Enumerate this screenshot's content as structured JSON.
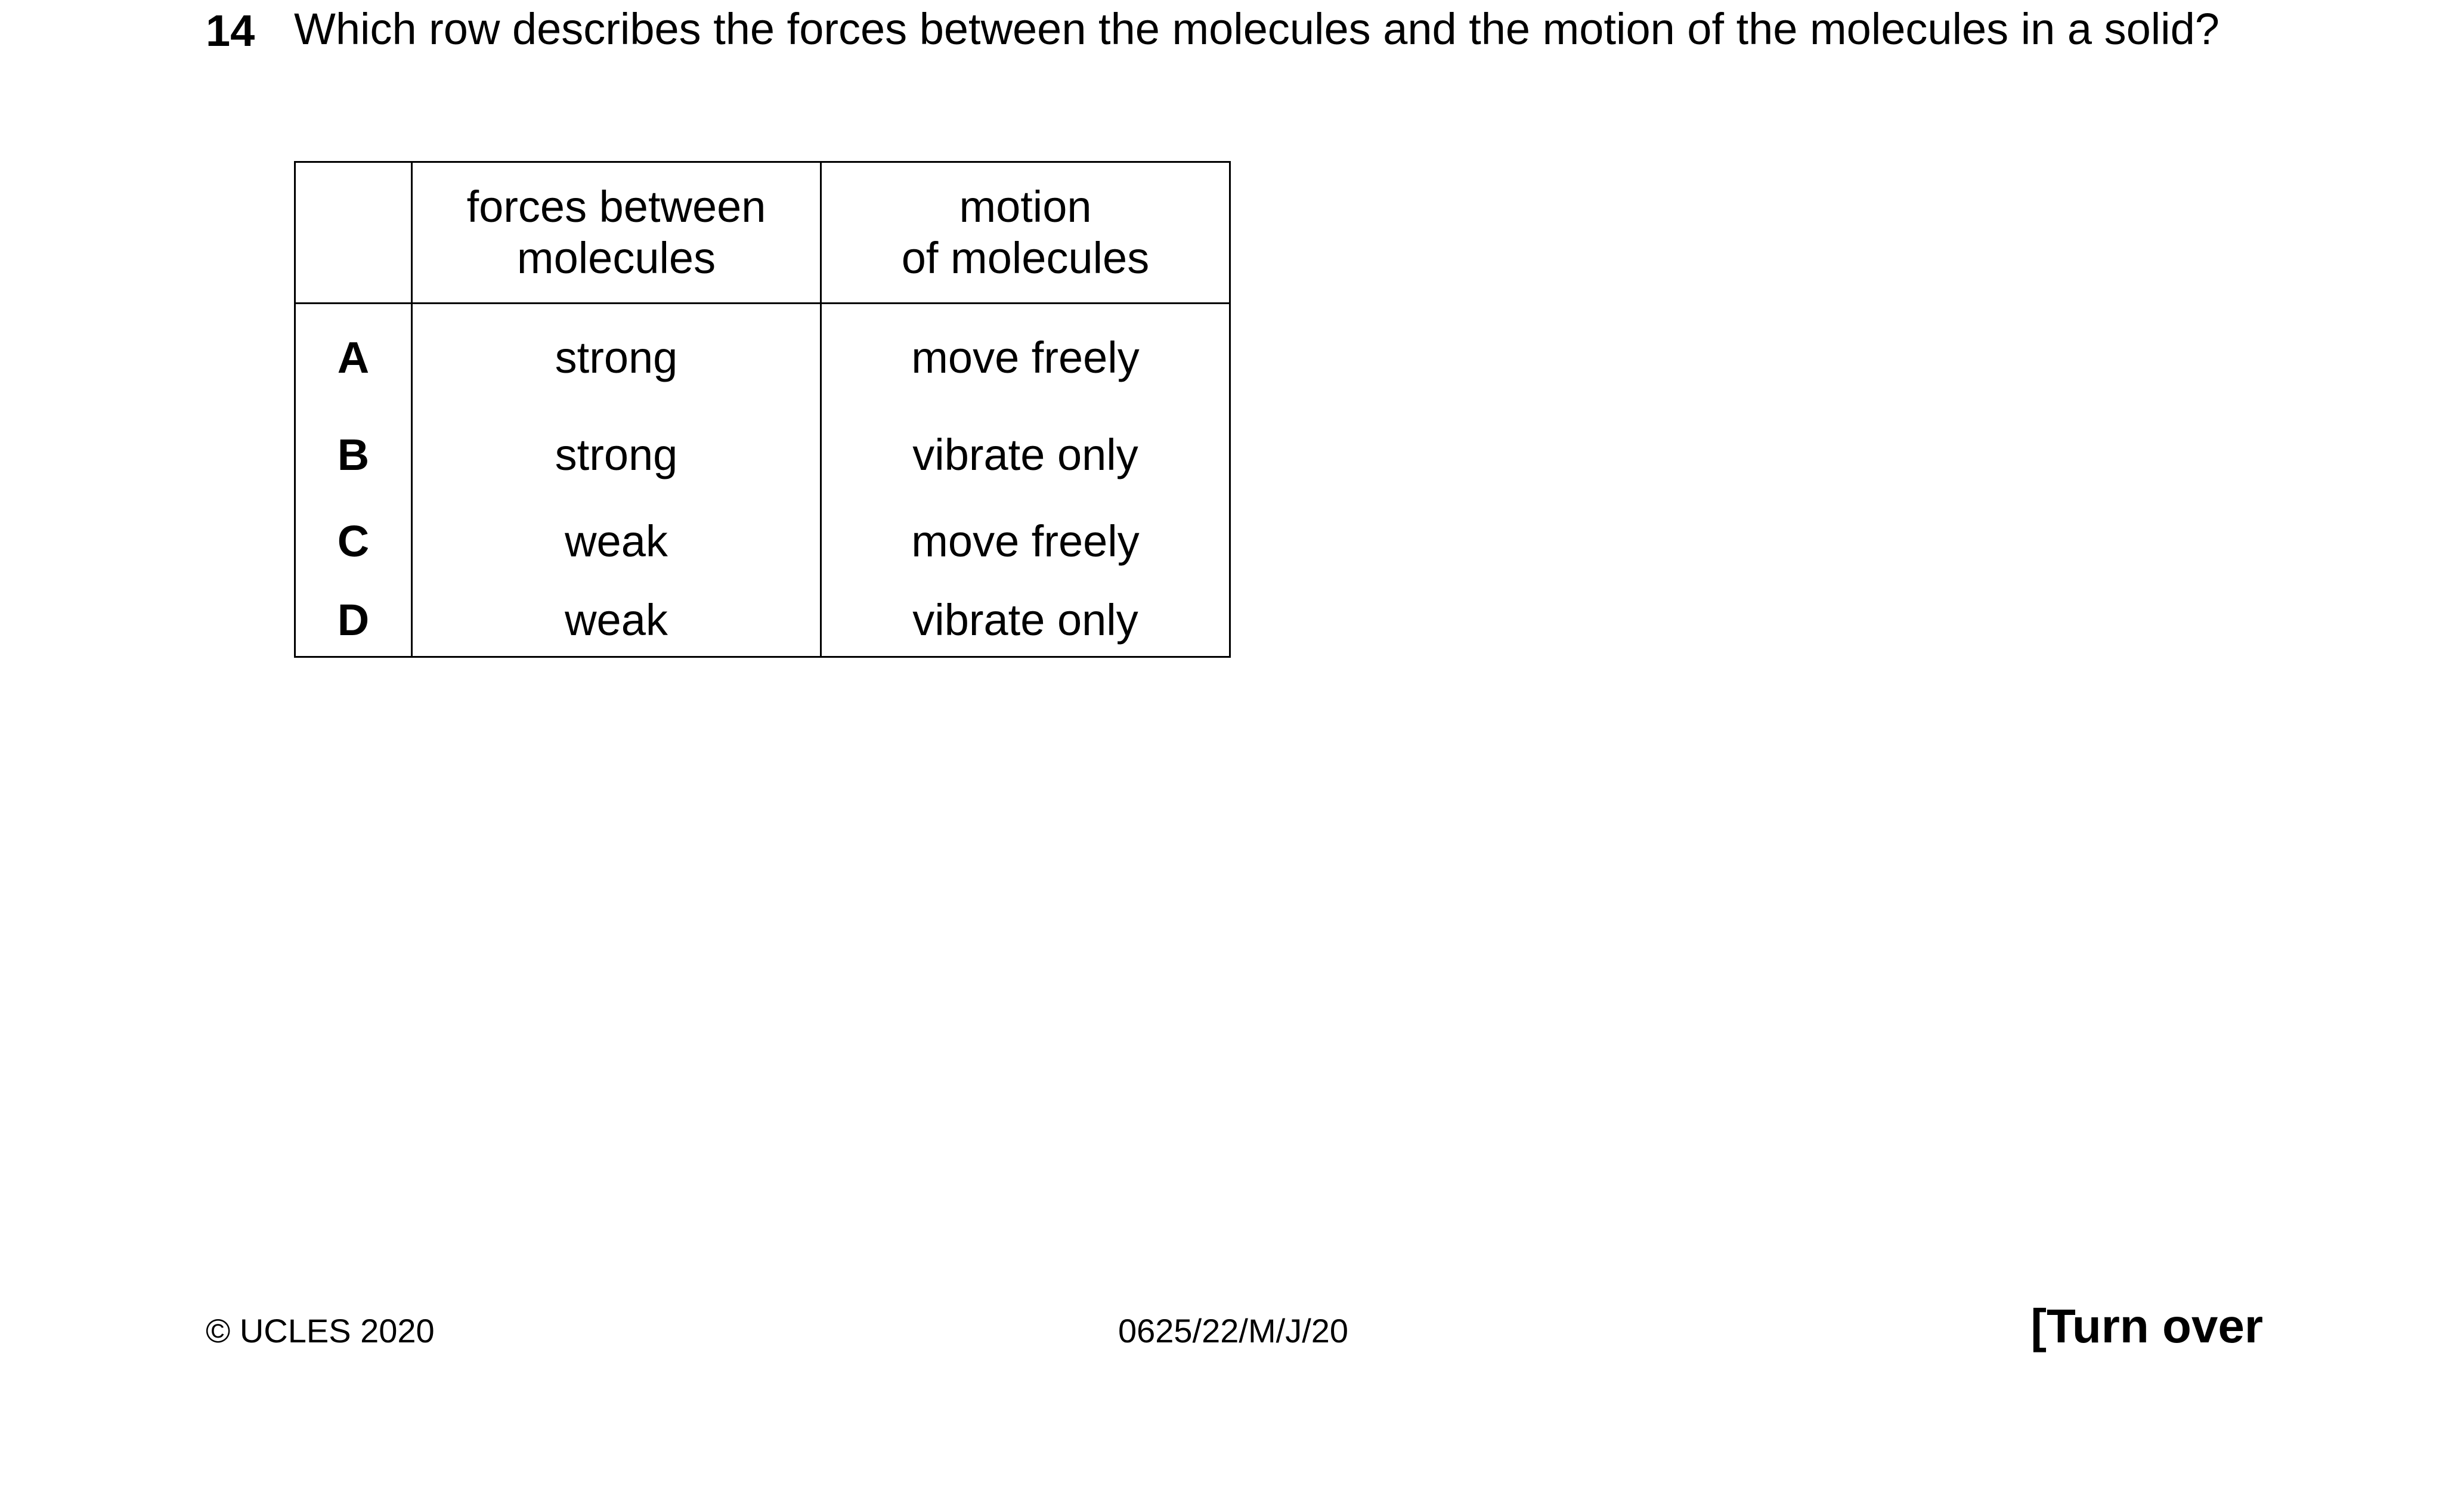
{
  "question": {
    "number": "14",
    "text": "Which row describes the forces between the molecules and the motion of the molecules in a solid?"
  },
  "table": {
    "headers": [
      "",
      "forces between molecules",
      "motion of molecules"
    ],
    "header_lines": {
      "forces": [
        "forces between",
        "molecules"
      ],
      "motion": [
        "motion",
        "of molecules"
      ]
    },
    "rows": [
      {
        "letter": "A",
        "forces": "strong",
        "motion": "move freely"
      },
      {
        "letter": "B",
        "forces": "strong",
        "motion": "vibrate only"
      },
      {
        "letter": "C",
        "forces": "weak",
        "motion": "move freely"
      },
      {
        "letter": "D",
        "forces": "weak",
        "motion": "vibrate only"
      }
    ]
  },
  "footer": {
    "copyright": "© UCLES 2020",
    "paper_code": "0625/22/M/J/20",
    "turn_over": "[Turn over"
  }
}
